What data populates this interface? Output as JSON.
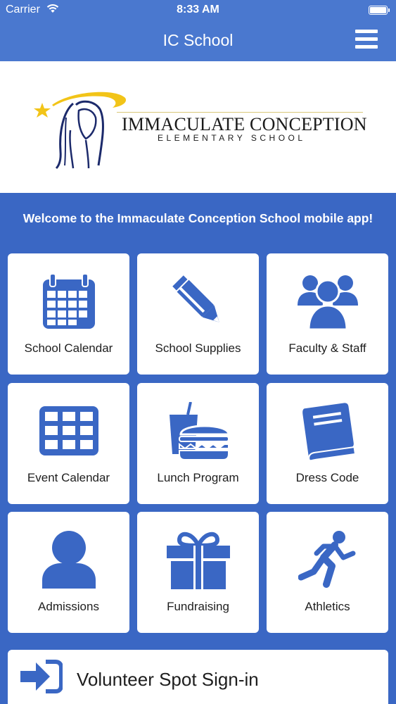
{
  "status_bar": {
    "carrier": "Carrier",
    "time": "8:33 AM"
  },
  "nav": {
    "title": "IC School",
    "menu_icon": "hamburger-menu-icon"
  },
  "logo": {
    "name": "IMMACULATE CONCEPTION",
    "subtitle": "ELEMENTARY SCHOOL"
  },
  "welcome": "Welcome to the Immaculate Conception School mobile app!",
  "tiles": [
    {
      "label": "School Calendar",
      "icon": "calendar-icon"
    },
    {
      "label": "School Supplies",
      "icon": "pencil-icon"
    },
    {
      "label": "Faculty & Staff",
      "icon": "group-icon"
    },
    {
      "label": "Event Calendar",
      "icon": "grid-calendar-icon"
    },
    {
      "label": "Lunch Program",
      "icon": "burger-drink-icon"
    },
    {
      "label": "Dress Code",
      "icon": "book-icon"
    },
    {
      "label": "Admissions",
      "icon": "person-icon"
    },
    {
      "label": "Fundraising",
      "icon": "gift-icon"
    },
    {
      "label": "Athletics",
      "icon": "runner-icon"
    }
  ],
  "volunteer": {
    "label": "Volunteer Spot Sign-in",
    "icon": "sign-in-icon"
  },
  "colors": {
    "primary_blue": "#3a67c4",
    "header_blue": "#4a78cf",
    "icon_blue": "#3a67c4",
    "logo_gold": "#f2c418",
    "logo_navy": "#1c2a6b"
  }
}
